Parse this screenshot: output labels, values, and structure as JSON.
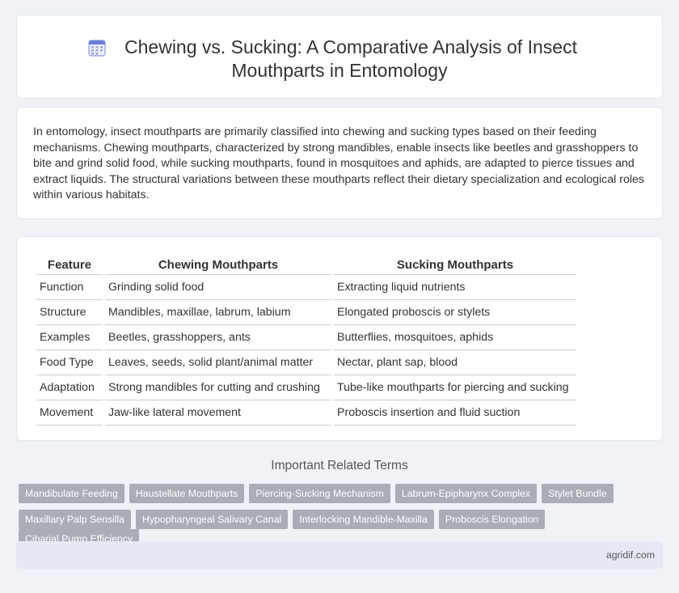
{
  "header": {
    "title_line1": "Chewing vs. Sucking: A Comparative Analysis of Insect",
    "title_line2": "Mouthparts in Entomology",
    "icon": "calendar-grid-icon"
  },
  "intro": {
    "text": "In entomology, insect mouthparts are primarily classified into chewing and sucking types based on their feeding mechanisms. Chewing mouthparts, characterized by strong mandibles, enable insects like beetles and grasshoppers to bite and grind solid food, while sucking mouthparts, found in mosquitoes and aphids, are adapted to pierce tissues and extract liquids. The structural variations between these mouthparts reflect their dietary specialization and ecological roles within various habitats."
  },
  "table": {
    "headers": [
      "Feature",
      "Chewing Mouthparts",
      "Sucking Mouthparts"
    ],
    "rows": [
      [
        "Function",
        "Grinding solid food",
        "Extracting liquid nutrients"
      ],
      [
        "Structure",
        "Mandibles, maxillae, labrum, labium",
        "Elongated proboscis or stylets"
      ],
      [
        "Examples",
        "Beetles, grasshoppers, ants",
        "Butterflies, mosquitoes, aphids"
      ],
      [
        "Food Type",
        "Leaves, seeds, solid plant/animal matter",
        "Nectar, plant sap, blood"
      ],
      [
        "Adaptation",
        "Strong mandibles for cutting and crushing",
        "Tube-like mouthparts for piercing and sucking"
      ],
      [
        "Movement",
        "Jaw-like lateral movement",
        "Proboscis insertion and fluid suction"
      ]
    ]
  },
  "related": {
    "heading": "Important Related Terms",
    "row1": [
      "Mandibulate Feeding",
      "Haustellate Mouthparts",
      "Piercing-Sucking Mechanism",
      "Labrum-Epipharynx Complex",
      "Stylet Bundle"
    ],
    "row2": [
      "Maxillary Palp Sensilla",
      "Hypopharyngeal Salivary Canal",
      "Interlocking Mandible-Maxilla",
      "Proboscis Elongation",
      "Cibarial Pump Efficiency"
    ]
  },
  "footer": {
    "site": "agridif.com"
  },
  "colors": {
    "tag_bg": "#a9adb5",
    "page_bg": "#f0f2f7",
    "footer_bg": "#e5e9f4",
    "icon_accent": "#6a7fd6"
  }
}
